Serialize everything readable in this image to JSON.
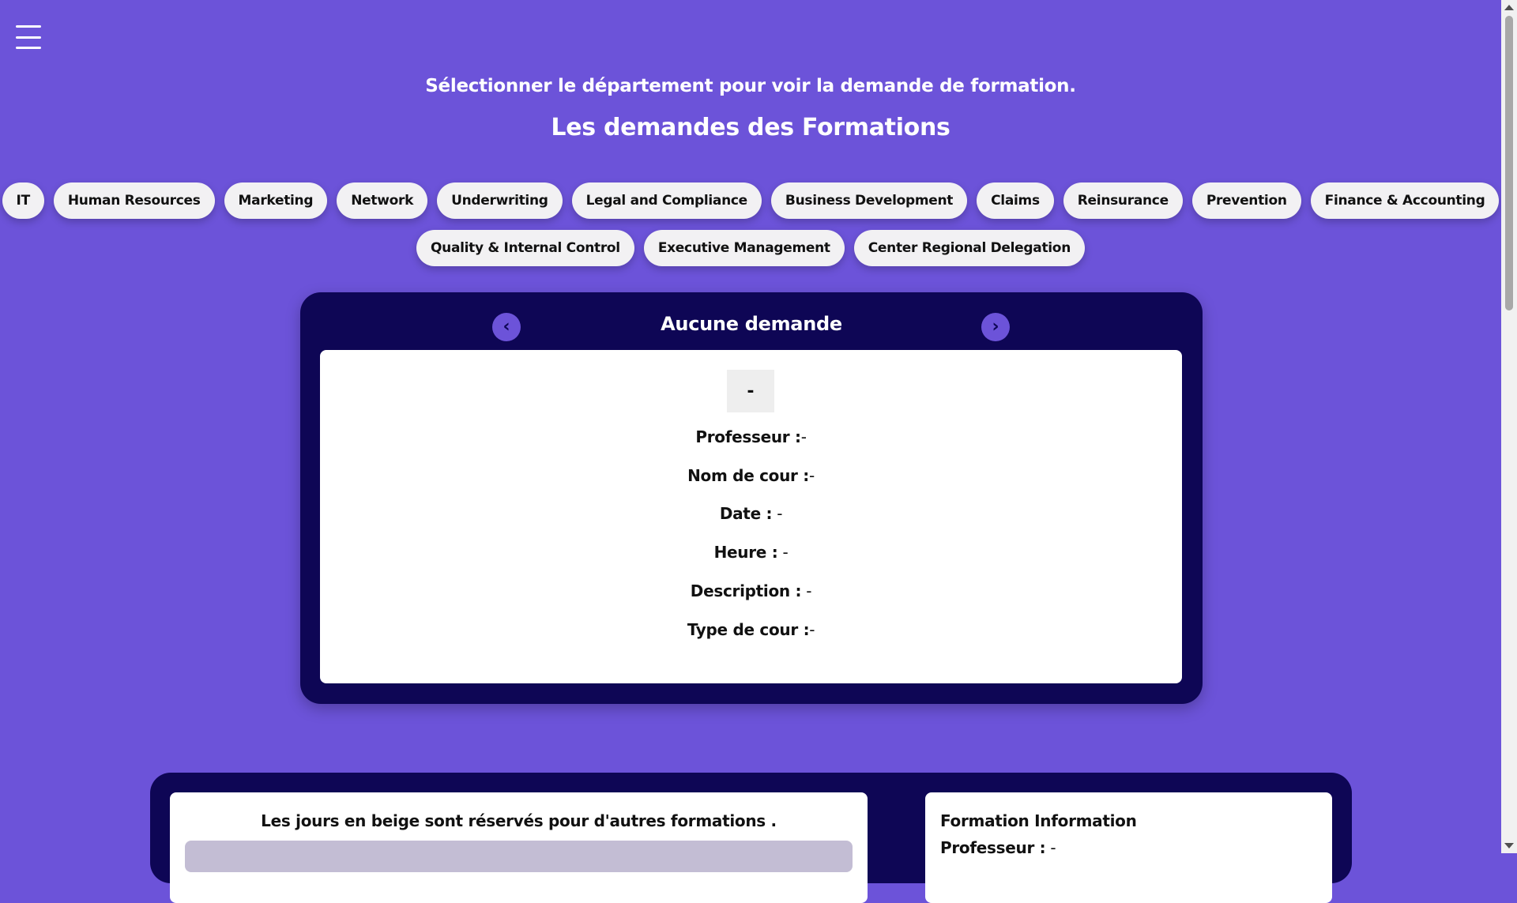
{
  "header": {
    "subtitle": "Sélectionner le département pour voir la demande de formation.",
    "title": "Les demandes des Formations"
  },
  "departments_row1": [
    "IT",
    "Human Resources",
    "Marketing",
    "Network",
    "Underwriting",
    "Legal and Compliance",
    "Business Development",
    "Claims",
    "Reinsurance",
    "Prevention",
    "Finance & Accounting"
  ],
  "departments_row2": [
    "Quality & Internal Control",
    "Executive Management",
    "Center Regional Delegation"
  ],
  "card": {
    "title": "Aucune demande",
    "prev_icon": "chevron-left-icon",
    "next_icon": "chevron-right-icon",
    "badge": "-",
    "fields": [
      {
        "label": "Professeur :",
        "value": "-"
      },
      {
        "label": "Nom de cour :",
        "value": "-"
      },
      {
        "label": "Date :",
        "value": " -"
      },
      {
        "label": "Heure :",
        "value": " -"
      },
      {
        "label": "Description :",
        "value": " -"
      },
      {
        "label": "Type de cour :",
        "value": "-"
      }
    ]
  },
  "calendar_panel": {
    "note": "Les jours en beige sont réservés pour d'autres formations ."
  },
  "info_panel": {
    "title": "Formation Information",
    "professeur_label": "Professeur :",
    "professeur_value": " -"
  },
  "colors": {
    "background": "#6c53d9",
    "card": "#0e0655",
    "pill": "#f2f1f3"
  }
}
